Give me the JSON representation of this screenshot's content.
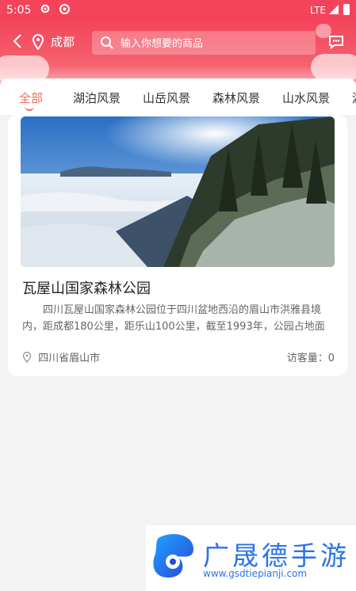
{
  "status_bar": {
    "time": "5:05",
    "network": "LTE"
  },
  "header": {
    "city": "成都",
    "search_placeholder": "输入你想要的商品"
  },
  "tabs": [
    "全部",
    "湖泊风景",
    "山岳风景",
    "森林风景",
    "山水风景",
    "湖"
  ],
  "card": {
    "title": "瓦屋山国家森林公园",
    "description": "四川瓦屋山国家森林公园位于四川盆地西沿的眉山市洪雅县境内，距成都180公里，距乐山100公里，截至1993年，公园占地面积…",
    "location": "四川省眉山市",
    "visits_label": "访客量：0"
  },
  "watermark": {
    "title": "广晟德手游",
    "url": "www.gsdtiepianji.com"
  },
  "colors": {
    "primary": "#f4445b",
    "accent": "#f06c58",
    "watermark": "#2b73e8"
  }
}
